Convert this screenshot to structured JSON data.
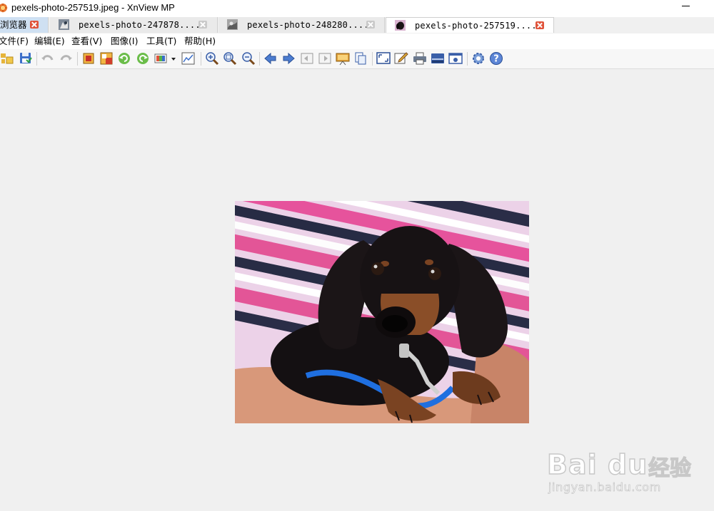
{
  "window": {
    "title": "pexels-photo-257519.jpeg - XnView MP"
  },
  "tabs": [
    {
      "label": "浏览器",
      "close": "red"
    },
    {
      "label": "pexels-photo-247878....",
      "close": "gray"
    },
    {
      "label": "pexels-photo-248280....",
      "close": "gray"
    },
    {
      "label": "pexels-photo-257519....",
      "close": "red",
      "active": true
    }
  ],
  "menu": [
    "文件(F)",
    "编辑(E)",
    "查看(V)",
    "图像(I)",
    "工具(T)",
    "帮助(H)"
  ],
  "toolbar": {
    "icons": [
      "open-folder-icon",
      "save-icon",
      "undo-icon",
      "redo-icon",
      "crop-icon",
      "resize-icon",
      "rotate-left-icon",
      "rotate-right-icon",
      "adjust-colors-icon",
      "histogram-icon",
      "zoom-in-icon",
      "zoom-fit-icon",
      "zoom-out-icon",
      "previous-icon",
      "next-icon",
      "first-page-icon",
      "last-page-icon",
      "slideshow-icon",
      "copy-icon",
      "fullscreen-icon",
      "edit-icon",
      "print-icon",
      "scanner-icon",
      "screenshot-icon",
      "settings-icon",
      "help-icon"
    ]
  },
  "colors": {
    "accent_close": "#e0533a",
    "active_tab": "#ffffff",
    "browser_tab": "#cfe0f2"
  },
  "watermark": {
    "logo": "Bai du",
    "cn": "经验",
    "url": "jingyan.baidu.com"
  }
}
